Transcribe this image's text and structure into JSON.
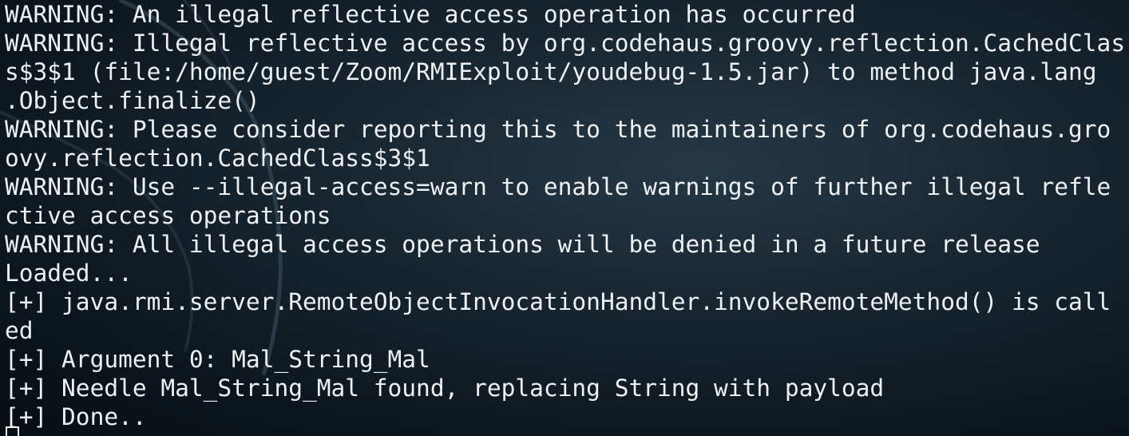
{
  "terminal": {
    "lines": [
      "WARNING: An illegal reflective access operation has occurred",
      "WARNING: Illegal reflective access by org.codehaus.groovy.reflection.CachedClas",
      "s$3$1 (file:/home/guest/Zoom/RMIExploit/youdebug-1.5.jar) to method java.lang",
      ".Object.finalize()",
      "WARNING: Please consider reporting this to the maintainers of org.codehaus.gro",
      "ovy.reflection.CachedClass$3$1",
      "WARNING: Use --illegal-access=warn to enable warnings of further illegal refle",
      "ctive access operations",
      "WARNING: All illegal access operations will be denied in a future release",
      "Loaded...",
      "[+] java.rmi.server.RemoteObjectInvocationHandler.invokeRemoteMethod() is call",
      "ed",
      "[+] Argument 0: Mal_String_Mal",
      "[+] Needle Mal_String_Mal found, replacing String with payload",
      "[+] Done.."
    ]
  },
  "colors": {
    "text": "#eef1f3",
    "background": "#101b24"
  }
}
